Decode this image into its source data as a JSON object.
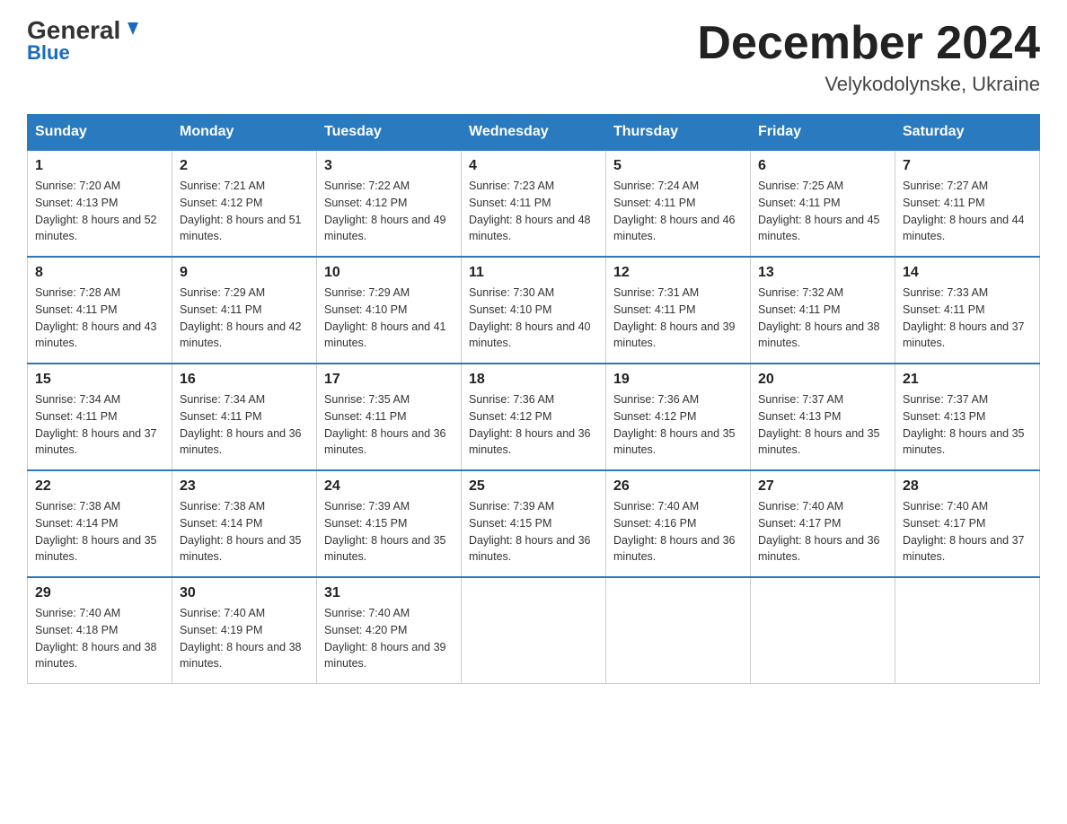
{
  "header": {
    "logo_general": "General",
    "logo_blue": "Blue",
    "month_year": "December 2024",
    "location": "Velykodolynske, Ukraine"
  },
  "days_of_week": [
    "Sunday",
    "Monday",
    "Tuesday",
    "Wednesday",
    "Thursday",
    "Friday",
    "Saturday"
  ],
  "weeks": [
    [
      {
        "day": "1",
        "sunrise": "7:20 AM",
        "sunset": "4:13 PM",
        "daylight": "8 hours and 52 minutes."
      },
      {
        "day": "2",
        "sunrise": "7:21 AM",
        "sunset": "4:12 PM",
        "daylight": "8 hours and 51 minutes."
      },
      {
        "day": "3",
        "sunrise": "7:22 AM",
        "sunset": "4:12 PM",
        "daylight": "8 hours and 49 minutes."
      },
      {
        "day": "4",
        "sunrise": "7:23 AM",
        "sunset": "4:11 PM",
        "daylight": "8 hours and 48 minutes."
      },
      {
        "day": "5",
        "sunrise": "7:24 AM",
        "sunset": "4:11 PM",
        "daylight": "8 hours and 46 minutes."
      },
      {
        "day": "6",
        "sunrise": "7:25 AM",
        "sunset": "4:11 PM",
        "daylight": "8 hours and 45 minutes."
      },
      {
        "day": "7",
        "sunrise": "7:27 AM",
        "sunset": "4:11 PM",
        "daylight": "8 hours and 44 minutes."
      }
    ],
    [
      {
        "day": "8",
        "sunrise": "7:28 AM",
        "sunset": "4:11 PM",
        "daylight": "8 hours and 43 minutes."
      },
      {
        "day": "9",
        "sunrise": "7:29 AM",
        "sunset": "4:11 PM",
        "daylight": "8 hours and 42 minutes."
      },
      {
        "day": "10",
        "sunrise": "7:29 AM",
        "sunset": "4:10 PM",
        "daylight": "8 hours and 41 minutes."
      },
      {
        "day": "11",
        "sunrise": "7:30 AM",
        "sunset": "4:10 PM",
        "daylight": "8 hours and 40 minutes."
      },
      {
        "day": "12",
        "sunrise": "7:31 AM",
        "sunset": "4:11 PM",
        "daylight": "8 hours and 39 minutes."
      },
      {
        "day": "13",
        "sunrise": "7:32 AM",
        "sunset": "4:11 PM",
        "daylight": "8 hours and 38 minutes."
      },
      {
        "day": "14",
        "sunrise": "7:33 AM",
        "sunset": "4:11 PM",
        "daylight": "8 hours and 37 minutes."
      }
    ],
    [
      {
        "day": "15",
        "sunrise": "7:34 AM",
        "sunset": "4:11 PM",
        "daylight": "8 hours and 37 minutes."
      },
      {
        "day": "16",
        "sunrise": "7:34 AM",
        "sunset": "4:11 PM",
        "daylight": "8 hours and 36 minutes."
      },
      {
        "day": "17",
        "sunrise": "7:35 AM",
        "sunset": "4:11 PM",
        "daylight": "8 hours and 36 minutes."
      },
      {
        "day": "18",
        "sunrise": "7:36 AM",
        "sunset": "4:12 PM",
        "daylight": "8 hours and 36 minutes."
      },
      {
        "day": "19",
        "sunrise": "7:36 AM",
        "sunset": "4:12 PM",
        "daylight": "8 hours and 35 minutes."
      },
      {
        "day": "20",
        "sunrise": "7:37 AM",
        "sunset": "4:13 PM",
        "daylight": "8 hours and 35 minutes."
      },
      {
        "day": "21",
        "sunrise": "7:37 AM",
        "sunset": "4:13 PM",
        "daylight": "8 hours and 35 minutes."
      }
    ],
    [
      {
        "day": "22",
        "sunrise": "7:38 AM",
        "sunset": "4:14 PM",
        "daylight": "8 hours and 35 minutes."
      },
      {
        "day": "23",
        "sunrise": "7:38 AM",
        "sunset": "4:14 PM",
        "daylight": "8 hours and 35 minutes."
      },
      {
        "day": "24",
        "sunrise": "7:39 AM",
        "sunset": "4:15 PM",
        "daylight": "8 hours and 35 minutes."
      },
      {
        "day": "25",
        "sunrise": "7:39 AM",
        "sunset": "4:15 PM",
        "daylight": "8 hours and 36 minutes."
      },
      {
        "day": "26",
        "sunrise": "7:40 AM",
        "sunset": "4:16 PM",
        "daylight": "8 hours and 36 minutes."
      },
      {
        "day": "27",
        "sunrise": "7:40 AM",
        "sunset": "4:17 PM",
        "daylight": "8 hours and 36 minutes."
      },
      {
        "day": "28",
        "sunrise": "7:40 AM",
        "sunset": "4:17 PM",
        "daylight": "8 hours and 37 minutes."
      }
    ],
    [
      {
        "day": "29",
        "sunrise": "7:40 AM",
        "sunset": "4:18 PM",
        "daylight": "8 hours and 38 minutes."
      },
      {
        "day": "30",
        "sunrise": "7:40 AM",
        "sunset": "4:19 PM",
        "daylight": "8 hours and 38 minutes."
      },
      {
        "day": "31",
        "sunrise": "7:40 AM",
        "sunset": "4:20 PM",
        "daylight": "8 hours and 39 minutes."
      },
      null,
      null,
      null,
      null
    ]
  ]
}
